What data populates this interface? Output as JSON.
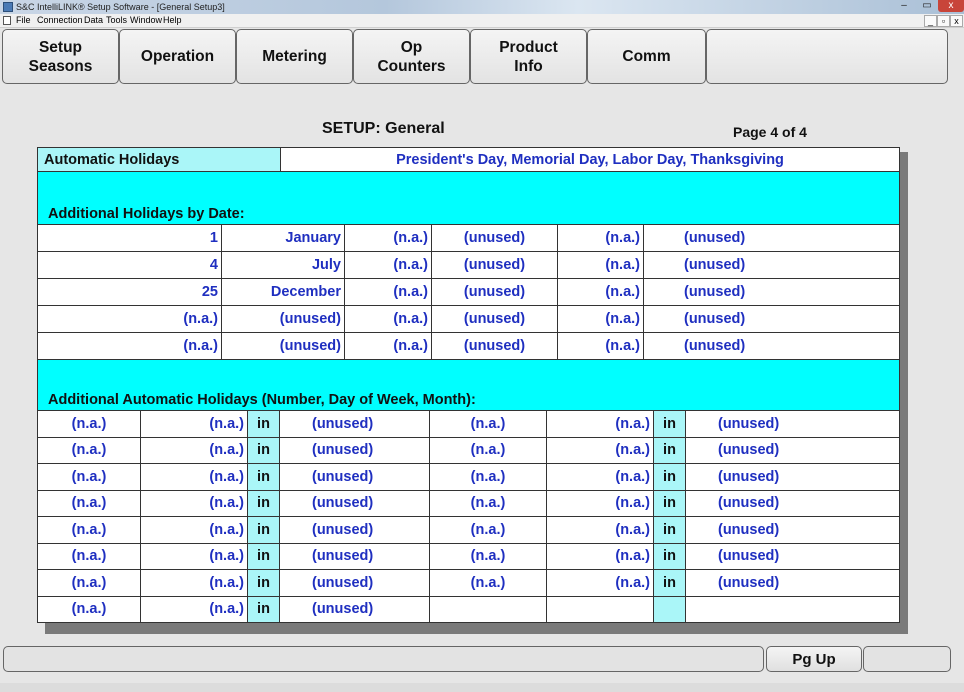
{
  "window": {
    "title": "S&C IntelliLINK® Setup Software - [General Setup3]",
    "controls": {
      "minimize": "–",
      "maximize": "▭",
      "close": "x"
    },
    "mdi_controls": [
      "_",
      "▫",
      "x"
    ]
  },
  "menu": [
    "File",
    "Connection",
    "Data",
    "Tools",
    "Window",
    "Help"
  ],
  "nav_buttons": [
    {
      "label": "Setup\nSeasons"
    },
    {
      "label": "Operation"
    },
    {
      "label": "Metering"
    },
    {
      "label": "Op\nCounters"
    },
    {
      "label": "Product\nInfo"
    },
    {
      "label": "Comm"
    },
    {
      "label": ""
    }
  ],
  "header": {
    "title": "SETUP: General",
    "page": "Page 4 of 4"
  },
  "auto_holidays": {
    "label": "Automatic Holidays",
    "value": "President's Day, Memorial Day, Labor Day, Thanksgiving"
  },
  "by_date": {
    "heading": "Additional Holidays by Date:",
    "rows": [
      [
        "1",
        "January",
        "(n.a.)",
        "(unused)",
        "(n.a.)",
        "(unused)"
      ],
      [
        "4",
        "July",
        "(n.a.)",
        "(unused)",
        "(n.a.)",
        "(unused)"
      ],
      [
        "25",
        "December",
        "(n.a.)",
        "(unused)",
        "(n.a.)",
        "(unused)"
      ],
      [
        "(n.a.)",
        "(unused)",
        "(n.a.)",
        "(unused)",
        "(n.a.)",
        "(unused)"
      ],
      [
        "(n.a.)",
        "(unused)",
        "(n.a.)",
        "(unused)",
        "(n.a.)",
        "(unused)"
      ]
    ]
  },
  "auto_by_rule": {
    "heading": "Additional Automatic Holidays (Number, Day of Week, Month):",
    "in_label": "in",
    "rows": [
      [
        "(n.a.)",
        "(n.a.)",
        "in",
        "(unused)",
        "(n.a.)",
        "(n.a.)",
        "in",
        "(unused)"
      ],
      [
        "(n.a.)",
        "(n.a.)",
        "in",
        "(unused)",
        "(n.a.)",
        "(n.a.)",
        "in",
        "(unused)"
      ],
      [
        "(n.a.)",
        "(n.a.)",
        "in",
        "(unused)",
        "(n.a.)",
        "(n.a.)",
        "in",
        "(unused)"
      ],
      [
        "(n.a.)",
        "(n.a.)",
        "in",
        "(unused)",
        "(n.a.)",
        "(n.a.)",
        "in",
        "(unused)"
      ],
      [
        "(n.a.)",
        "(n.a.)",
        "in",
        "(unused)",
        "(n.a.)",
        "(n.a.)",
        "in",
        "(unused)"
      ],
      [
        "(n.a.)",
        "(n.a.)",
        "in",
        "(unused)",
        "(n.a.)",
        "(n.a.)",
        "in",
        "(unused)"
      ],
      [
        "(n.a.)",
        "(n.a.)",
        "in",
        "(unused)",
        "(n.a.)",
        "(n.a.)",
        "in",
        "(unused)"
      ],
      [
        "(n.a.)",
        "(n.a.)",
        "in",
        "(unused)",
        "",
        "",
        "",
        ""
      ]
    ]
  },
  "status": {
    "pg_up": "Pg Up"
  },
  "colors": {
    "value_text": "#1f2fc0",
    "section_bg": "#00ffff",
    "label_bg": "#aaf6f8"
  }
}
